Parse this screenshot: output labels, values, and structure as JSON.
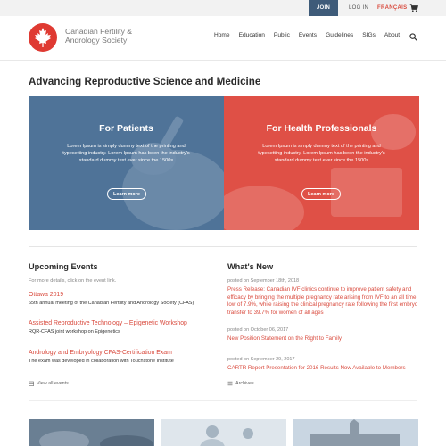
{
  "topbar": {
    "join_label": "JOIN",
    "login_label": "LOG IN",
    "language_label": "FRANÇAIS",
    "cart_icon": "cart-icon"
  },
  "header": {
    "logo_text": "Canadian Fertility & Andrology Society",
    "nav": [
      "Home",
      "Education",
      "Public",
      "Events",
      "Guidelines",
      "SIGs",
      "About"
    ],
    "search_icon": "search-icon"
  },
  "hero": {
    "title": "Advancing Reproductive Science and Medicine"
  },
  "panels": {
    "patients": {
      "title": "For Patients",
      "text": "Lorem Ipsum is simply dummy text of the printing and typesetting industry. Lorem Ipsum has been the industry's standard dummy text ever since the 1500s",
      "button": "Learn more"
    },
    "professionals": {
      "title": "For Health Professionals",
      "text": "Lorem Ipsum is simply dummy text of the printing and typesetting industry. Lorem Ipsum has been the industry's standard dummy text ever since the 1500s",
      "button": "Learn more"
    }
  },
  "events": {
    "title": "Upcoming Events",
    "note": "For more details, click on the event link.",
    "items": [
      {
        "title": "Ottawa 2019",
        "desc": "65th annual meeting of the Canadian Fertility and Andrology Society (CFAS)"
      },
      {
        "title": "Assisted Reproductive Technology – Epigenetic Workshop",
        "desc": "RQR-CFAS joint workshop on Epigenetics"
      },
      {
        "title": "Andrology and Embryology CFAS-Certification Exam",
        "desc": "The exam was developed in collaboration with Touchstone Institute"
      }
    ],
    "view_all": "View all events"
  },
  "news": {
    "title": "What's New",
    "items": [
      {
        "date": "posted on September 18th, 2018",
        "title": "Press Release: Canadian IVF clinics continue to improve patient safety and efficacy by bringing the multiple pregnancy rate arising from IVF to an all time low of 7.9%, while raising the clinical pregnancy rate following the first embryo transfer to 39.7% for women of all ages"
      },
      {
        "date": "posted on October 06, 2017",
        "title": "New Position Statement on the Right to Family"
      },
      {
        "date": "posted on September 29, 2017",
        "title": "CARTR Report Presentation for 2016 Results Now Available to Members"
      }
    ],
    "archives": "Archives"
  },
  "colors": {
    "brand_red": "#df5046",
    "brand_blue": "#4f7398",
    "link_red": "#d94a3d"
  }
}
